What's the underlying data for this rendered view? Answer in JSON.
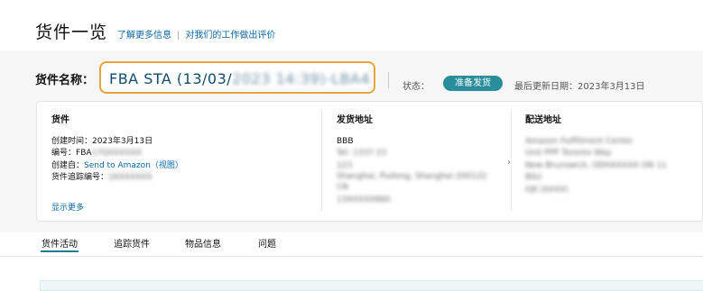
{
  "header": {
    "title": "货件一览",
    "link1": "了解更多信息",
    "link2": "对我们的工作做出评价"
  },
  "shipment": {
    "name_label": "货件名称：",
    "name_prefix": "FBA STA (13/03/",
    "name_blurred": "2023 14:39)-LBA4",
    "status_label": "状态：",
    "status_value": "准备发货",
    "updated": "最后更新日期：2023年3月13日"
  },
  "details": {
    "shipment_col": {
      "title": "货件",
      "created_label": "创建时间：",
      "created_value": "2023年3月13日",
      "number_label": "编号：",
      "number_value": "FBA",
      "number_blurred": "17QXXXXXX",
      "created_by_label": "创建自：",
      "created_by_link": "Send to Amazon（视图）",
      "tracking_label": "货件追踪编号：",
      "tracking_blurred": "1KXXXXXX",
      "show_more": "显示更多"
    },
    "ship_from": {
      "title": "发货地址",
      "name": "BBB",
      "line1": "Tel: 1337 23",
      "line2": "123",
      "line3": "Shanghai, Pudong, Shanghai 200122",
      "line4": "CN",
      "line5": "13XXXXX860"
    },
    "ship_to": {
      "title": "配送地址",
      "line1": "Amazon Fulfillment Center",
      "line2": "Unit PPP Toronto Way",
      "line3": "New Brunswick, ODHXXXXX ON 11",
      "line4": "BSU",
      "line5": "GB (XXXX)"
    }
  },
  "tabs": [
    "货件活动",
    "追踪货件",
    "物品信息",
    "问题"
  ],
  "colors": {
    "accent": "#2a8d9b",
    "link": "#0a66a8",
    "highlight": "#e8a33a"
  }
}
